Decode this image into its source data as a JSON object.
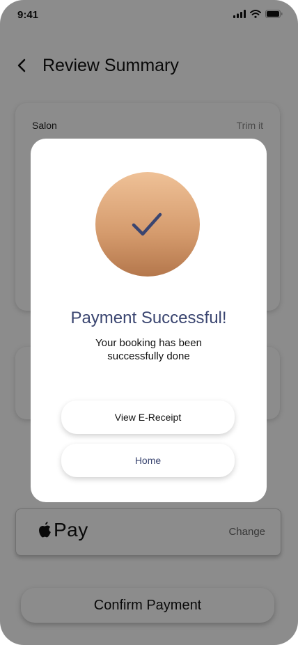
{
  "status_bar": {
    "time": "9:41"
  },
  "header": {
    "title": "Review Summary"
  },
  "summary": {
    "rows": [
      {
        "label": "Salon",
        "value": "Trim it"
      }
    ]
  },
  "payment": {
    "method_label": "Pay",
    "change_label": "Change"
  },
  "confirm_button": {
    "label": "Confirm Payment"
  },
  "modal": {
    "title": "Payment Successful!",
    "message_line1": "Your booking has been",
    "message_line2": "successfully done",
    "receipt_button": "View E-Receipt",
    "home_button": "Home"
  },
  "colors": {
    "accent": "#3a4570",
    "success_circle_top": "#efc197",
    "success_circle_bottom": "#b4774c",
    "overlay": "rgba(0,0,0,0.45)"
  },
  "icons": [
    "back-arrow-icon",
    "signal-icon",
    "wifi-icon",
    "battery-icon",
    "apple-logo-icon",
    "checkmark-icon"
  ]
}
